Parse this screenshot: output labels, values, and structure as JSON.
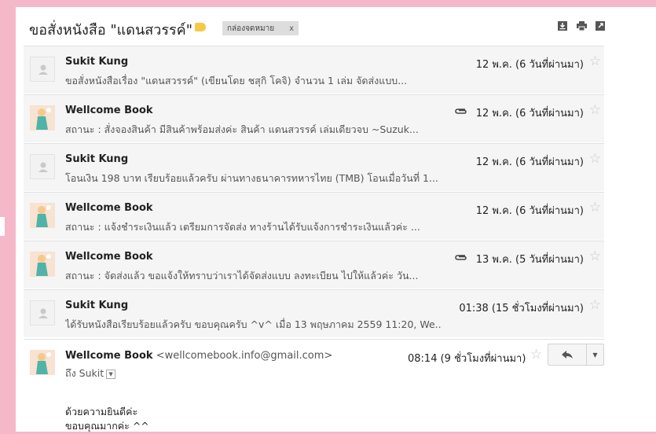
{
  "thread": {
    "subject": "ขอสั่งหนังสือ \"แดนสวรรค์\"",
    "label": "กล่องจดหมาย",
    "label_remove": "x"
  },
  "toolbar": {
    "icons": [
      "download-icon",
      "print-icon",
      "new-window-icon"
    ]
  },
  "messages": [
    {
      "sender": "Sukit Kung",
      "snippet": "ขอสั่งหนังสือเรื่อง \"แดนสวรรค์\" (เขียนโดย ชสุกิ โคจิ) จำนวน 1 เล่ม จัดส่งแบบ...",
      "date": "12 พ.ค. (6 วันที่ผ่านมา)",
      "attachment": false,
      "avatar": "generic"
    },
    {
      "sender": "Wellcome Book",
      "snippet": "สถานะ : สั่งจองสินค้า มีสินค้าพร้อมส่งค่ะ สินค้า แดนสวรรค์ เล่มเดียวจบ ~Suzuk...",
      "date": "12 พ.ค. (6 วันที่ผ่านมา)",
      "attachment": true,
      "avatar": "book"
    },
    {
      "sender": "Sukit Kung",
      "snippet": "โอนเงิน 198 บาท เรียบร้อยแล้วครับ ผ่านทางธนาคารทหารไทย (TMB) โอนเมื่อวันที่ 1...",
      "date": "12 พ.ค. (6 วันที่ผ่านมา)",
      "attachment": false,
      "avatar": "generic"
    },
    {
      "sender": "Wellcome Book",
      "snippet": "สถานะ : แจ้งชำระเงินแล้ว เตรียมการจัดส่ง ทางร้านได้รับแจ้งการชำระเงินแล้วค่ะ ...",
      "date": "12 พ.ค. (6 วันที่ผ่านมา)",
      "attachment": false,
      "avatar": "book"
    },
    {
      "sender": "Wellcome Book",
      "snippet": "สถานะ : จัดส่งแล้ว ขอแจ้งให้ทราบว่าเราได้จัดส่งแบบ ลงทะเบียน ไปให้แล้วค่ะ วัน...",
      "date": "13 พ.ค. (5 วันที่ผ่านมา)",
      "attachment": true,
      "avatar": "book"
    },
    {
      "sender": "Sukit Kung",
      "snippet": "ได้รับหนังสือเรียบร้อยแล้วครับ ขอบคุณครับ ^v^ เมื่อ 13 พฤษภาคม 2559 11:20, We...",
      "date": "01:38 (15 ชั่วโมงที่ผ่านมา)",
      "attachment": false,
      "avatar": "generic"
    }
  ],
  "open_message": {
    "sender": "Wellcome Book",
    "email": "<wellcomebook.info@gmail.com>",
    "to": "ถึง Sukit",
    "date": "08:14 (9 ชั่วโมงที่ผ่านมา)",
    "body": [
      "ด้วยความยินดีค่ะ",
      "ขอบคุณมากค่ะ ^^"
    ]
  }
}
